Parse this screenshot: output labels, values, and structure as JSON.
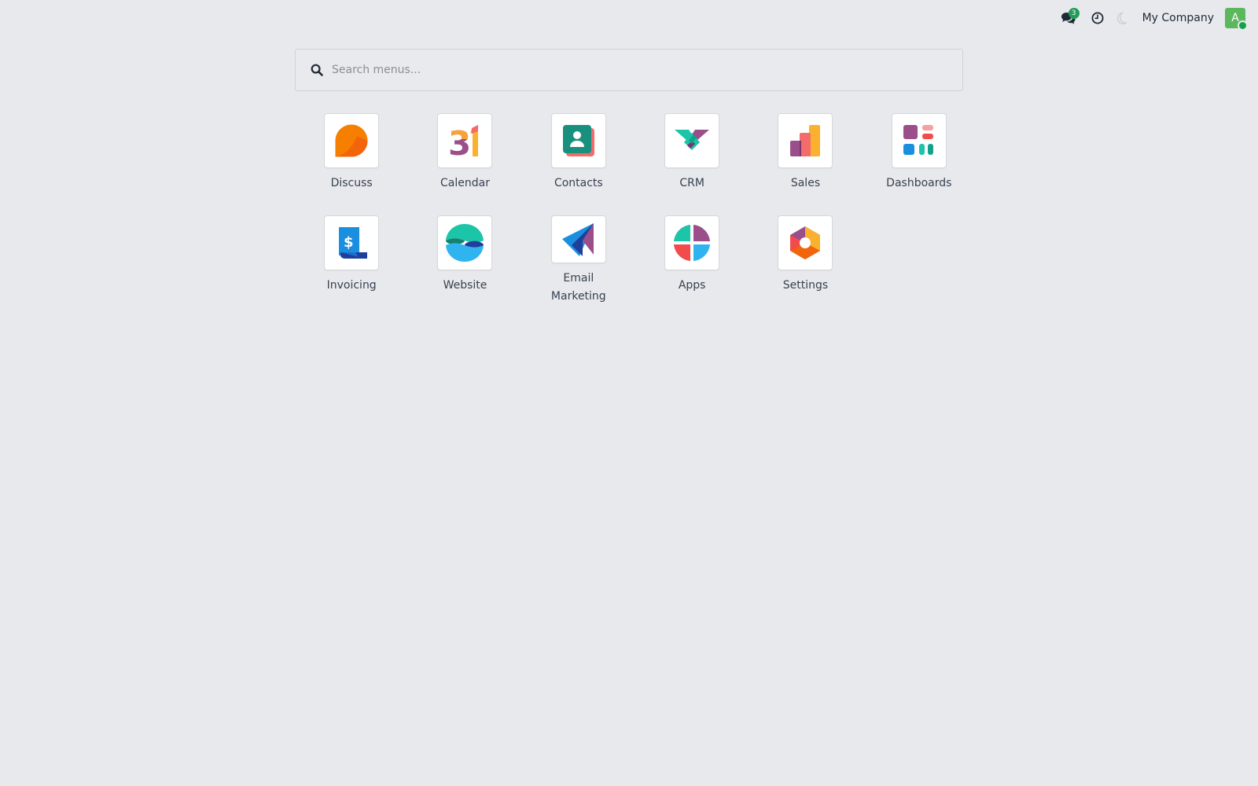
{
  "systray": {
    "chat_badge_count": "3",
    "chat_icon": "chat-bubbles-icon",
    "activity_icon": "clock-icon",
    "theme_icon": "moon-icon",
    "company_name": "My Company",
    "avatar_initial": "A",
    "avatar_color": "#5cb85c",
    "presence_color": "#12a14c"
  },
  "search": {
    "placeholder": "Search menus...",
    "value": "",
    "icon": "search-icon"
  },
  "apps": [
    {
      "label": "Discuss",
      "icon": "discuss-icon"
    },
    {
      "label": "Calendar",
      "icon": "calendar-icon"
    },
    {
      "label": "Contacts",
      "icon": "contacts-icon"
    },
    {
      "label": "CRM",
      "icon": "crm-icon"
    },
    {
      "label": "Sales",
      "icon": "sales-icon"
    },
    {
      "label": "Dashboards",
      "icon": "dashboards-icon"
    },
    {
      "label": "Invoicing",
      "icon": "invoicing-icon"
    },
    {
      "label": "Website",
      "icon": "website-icon"
    },
    {
      "label": "Email Marketing",
      "icon": "email-marketing-icon"
    },
    {
      "label": "Apps",
      "icon": "apps-icon"
    },
    {
      "label": "Settings",
      "icon": "settings-icon"
    }
  ],
  "colors": {
    "background": "#e8e9ec",
    "text": "#374151",
    "badge": "#1f9d55"
  }
}
